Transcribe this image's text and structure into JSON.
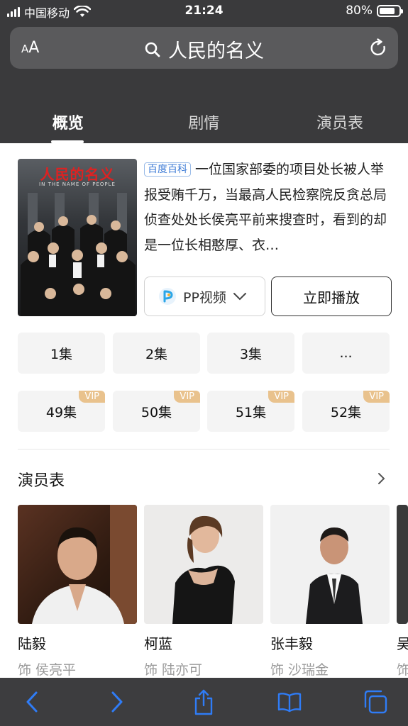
{
  "status_bar": {
    "carrier": "中国移动",
    "time": "21:24",
    "battery": "80%",
    "battery_level": 0.8
  },
  "address_bar": {
    "text_size_label": "AA",
    "query": "人民的名义"
  },
  "tabs": [
    {
      "label": "概览",
      "active": true
    },
    {
      "label": "剧情",
      "active": false
    },
    {
      "label": "演员表",
      "active": false
    }
  ],
  "overview": {
    "poster_title": "人民的名义",
    "poster_subtitle": "IN THE NAME OF PEOPLE",
    "baike_badge": "百度百科",
    "description": "一位国家部委的项目处长被人举报受贿千万，当最高人民检察院反贪总局侦查处处长侯亮平前来搜查时，看到的却是一位长相憨厚、衣…",
    "source_label": "PP视频",
    "play_label": "立即播放"
  },
  "episodes": {
    "row1": [
      "1集",
      "2集",
      "3集",
      "..."
    ],
    "row2": [
      "49集",
      "50集",
      "51集",
      "52集"
    ],
    "vip_label": "VIP"
  },
  "cast": {
    "title": "演员表",
    "members": [
      {
        "name": "陆毅",
        "role": "饰 侯亮平"
      },
      {
        "name": "柯蓝",
        "role": "饰 陆亦可"
      },
      {
        "name": "张丰毅",
        "role": "饰 沙瑞金"
      },
      {
        "name": "吴",
        "role": "饰"
      }
    ]
  },
  "colors": {
    "header_bg": "#3a3a3c",
    "toolbar_icon": "#2f7cf6",
    "vip_badge": "#e9c28d",
    "baike_blue": "#3d7bd6"
  },
  "icons": [
    "signal-icon",
    "wifi-icon",
    "battery-icon",
    "search-icon",
    "reload-icon",
    "pp-video-logo-icon",
    "chevron-down-icon",
    "chevron-right-icon",
    "back-icon",
    "forward-icon",
    "share-icon",
    "bookmarks-icon",
    "tabs-icon"
  ]
}
